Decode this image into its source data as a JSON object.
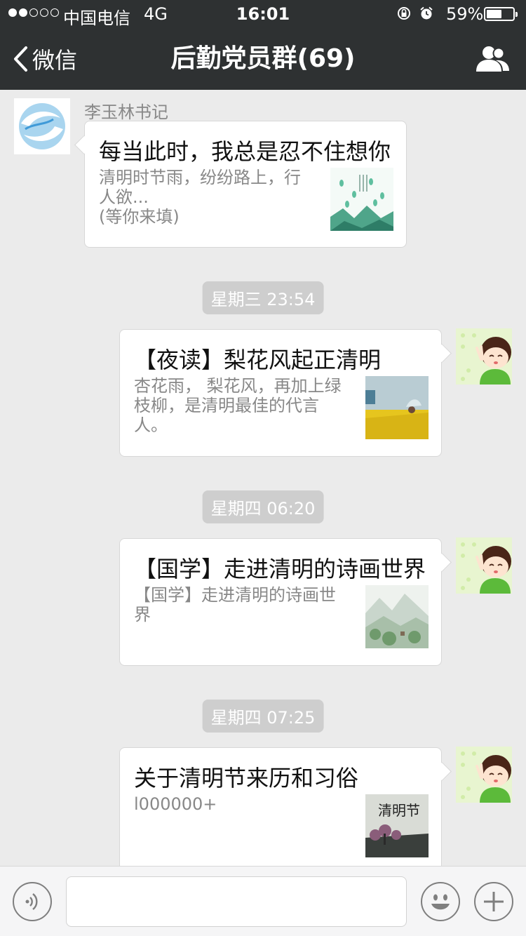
{
  "status": {
    "carrier": "中国电信",
    "network": "4G",
    "time": "16:01",
    "battery": "59%",
    "battery_level": 0.59,
    "signal_bars": 2
  },
  "nav": {
    "back_label": "微信",
    "title": "后勤党员群(69)"
  },
  "messages": [
    {
      "sender": "李玉林书记",
      "title": "每当此时，我总是忍不住想你",
      "desc": "清明时节雨，纷纷路上，行人欲...\n(等你来填)",
      "thumb_icon": "green-rain-illustration"
    },
    {
      "timestamp": "星期三 23:54",
      "title": "【夜读】梨花风起正清明",
      "desc": "杏花雨， 梨花风，再加上绿枝柳，是清明最佳的代言人。",
      "thumb_icon": "rapeseed-field-photo"
    },
    {
      "timestamp": "星期四 06:20",
      "title": "【国学】走进清明的诗画世界",
      "desc": "【国学】走进清明的诗画世界",
      "thumb_icon": "landscape-painting"
    },
    {
      "timestamp": "星期四 07:25",
      "title": "关于清明节来历和习俗",
      "desc": "l000000+",
      "thumb_icon": "qingming-poster",
      "thumb_text": "清明节"
    }
  ],
  "input": {
    "placeholder": ""
  },
  "colors": {
    "nav_bg": "#2e3132",
    "chat_bg": "#ebebeb",
    "time_pill_bg": "#cecece"
  }
}
